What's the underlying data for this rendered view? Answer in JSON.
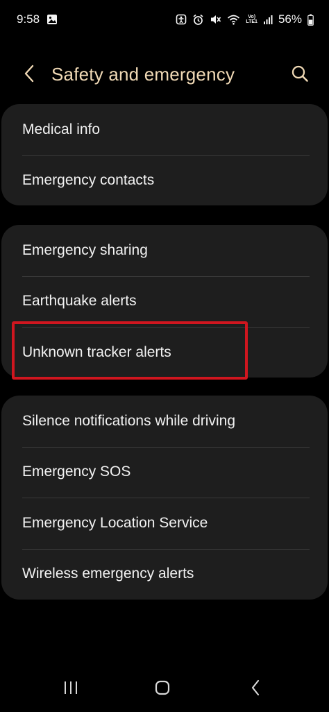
{
  "status_bar": {
    "time": "9:58",
    "battery": "56%",
    "lte_top": "Vo)",
    "lte_bottom": "LTE1",
    "icons": [
      "gallery-icon",
      "accessibility-icon",
      "alarm-icon",
      "mute-icon",
      "wifi-icon",
      "volte-icon",
      "signal-icon",
      "battery-icon"
    ]
  },
  "header": {
    "title": "Safety and emergency",
    "back_icon": "chevron-left-icon",
    "search_icon": "search-icon"
  },
  "groups": [
    {
      "items": [
        {
          "label": "Medical info"
        },
        {
          "label": "Emergency contacts"
        }
      ]
    },
    {
      "items": [
        {
          "label": "Emergency sharing"
        },
        {
          "label": "Earthquake alerts"
        },
        {
          "label": "Unknown tracker alerts"
        }
      ]
    },
    {
      "items": [
        {
          "label": "Silence notifications while driving"
        },
        {
          "label": "Emergency SOS"
        },
        {
          "label": "Emergency Location Service"
        },
        {
          "label": "Wireless emergency alerts"
        }
      ]
    }
  ],
  "highlight": {
    "target": "Unknown tracker alerts",
    "color": "#d0161f"
  },
  "colors": {
    "background": "#000000",
    "card": "#1e1e1e",
    "title": "#f0d9b5",
    "text": "#f2f2f2",
    "divider": "#3a3a3a"
  },
  "nav_bar": {
    "icons": [
      "recent-apps-icon",
      "home-icon",
      "back-icon"
    ]
  }
}
